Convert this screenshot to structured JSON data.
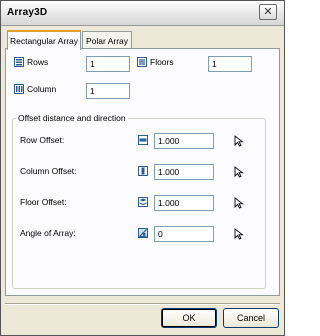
{
  "window": {
    "title": "Array3D"
  },
  "tabs": [
    {
      "label": "Rectangular Array"
    },
    {
      "label": "Polar Array"
    }
  ],
  "fields": {
    "rows": {
      "label": "Rows",
      "value": "1"
    },
    "floors": {
      "label": "Floors",
      "value": "1"
    },
    "column": {
      "label": "Column",
      "value": "1"
    }
  },
  "offset_group": {
    "title": "Offset distance and direction",
    "row_offset": {
      "label": "Row Offset:",
      "value": "1.000"
    },
    "column_offset": {
      "label": "Column Offset:",
      "value": "1.000"
    },
    "floor_offset": {
      "label": "Floor Offset:",
      "value": "1.000"
    },
    "angle": {
      "label": "Angle of Array:",
      "value": "0"
    }
  },
  "buttons": {
    "ok": "OK",
    "cancel": "Cancel"
  },
  "icons": {
    "close": "close-icon",
    "rows": "rows-icon",
    "floors": "floors-icon",
    "column": "column-icon",
    "row_offset": "row-offset-icon",
    "column_offset": "column-offset-icon",
    "floor_offset": "floor-offset-icon",
    "angle": "angle-icon",
    "pick": "pick-point-icon"
  },
  "colors": {
    "icon_blue": "#2a5c9a",
    "tab_accent": "#e5a12a",
    "face": "#ece9d8",
    "panel": "#fcfcfe"
  }
}
